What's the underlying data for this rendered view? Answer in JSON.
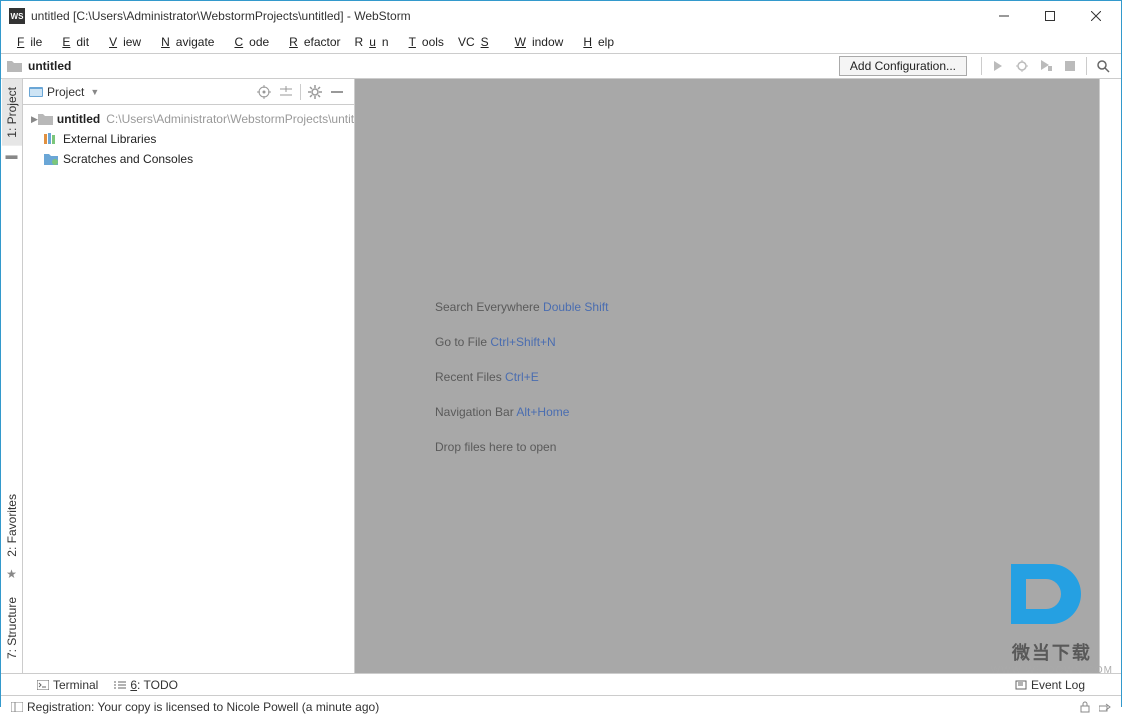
{
  "window": {
    "title": "untitled [C:\\Users\\Administrator\\WebstormProjects\\untitled] - WebStorm"
  },
  "menu": {
    "file": "File",
    "edit": "Edit",
    "view": "View",
    "navigate": "Navigate",
    "code": "Code",
    "refactor": "Refactor",
    "run": "Run",
    "tools": "Tools",
    "vcs": "VCS",
    "window": "Window",
    "help": "Help"
  },
  "nav": {
    "crumb": "untitled",
    "add_config": "Add Configuration..."
  },
  "gutter_left": {
    "project": "1: Project",
    "favorites": "2: Favorites",
    "structure": "7: Structure"
  },
  "project_panel": {
    "title": "Project",
    "tree": {
      "root_name": "untitled",
      "root_path": "C:\\Users\\Administrator\\WebstormProjects\\untitled",
      "external": "External Libraries",
      "scratches": "Scratches and Consoles"
    }
  },
  "editor_hints": [
    {
      "label": "Search Everywhere ",
      "shortcut": "Double Shift"
    },
    {
      "label": "Go to File ",
      "shortcut": "Ctrl+Shift+N"
    },
    {
      "label": "Recent Files ",
      "shortcut": "Ctrl+E"
    },
    {
      "label": "Navigation Bar ",
      "shortcut": "Alt+Home"
    },
    {
      "label": "Drop files here to open",
      "shortcut": ""
    }
  ],
  "bottom": {
    "terminal": "Terminal",
    "todo": "6: TODO",
    "eventlog": "Event Log"
  },
  "status": {
    "msg": "Registration: Your copy is licensed to Nicole Powell (a minute ago)"
  },
  "watermark": {
    "text": "微当下载",
    "url": "WWW.WEIDOWN.COM"
  }
}
